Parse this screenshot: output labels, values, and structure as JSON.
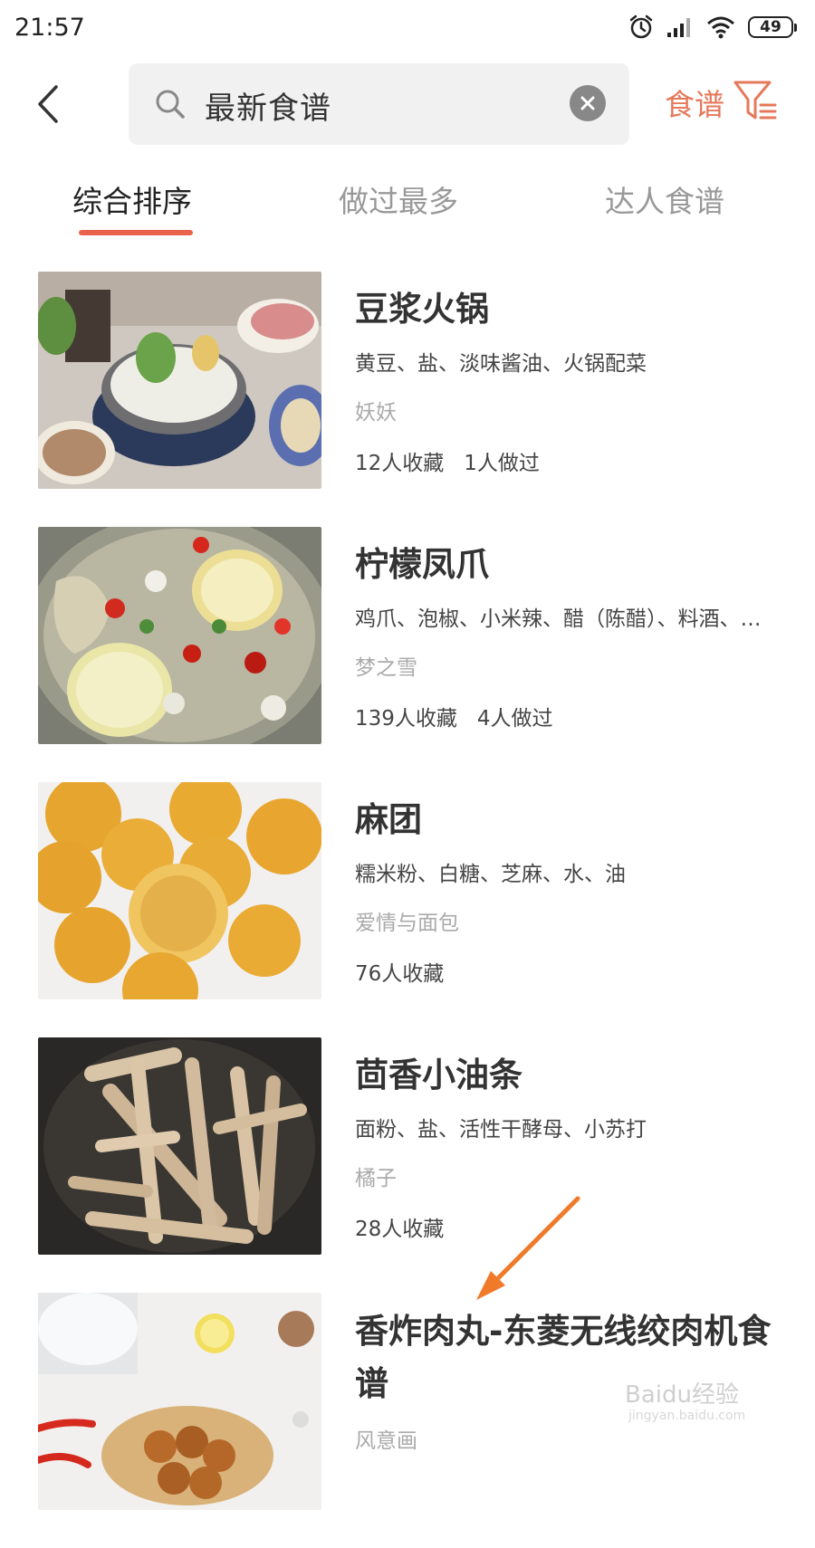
{
  "status_bar": {
    "time": "21:57",
    "battery": "49",
    "icons": [
      "alarm-icon",
      "signal-icon",
      "wifi-icon",
      "battery-icon"
    ]
  },
  "header": {
    "search_value": "最新食谱",
    "filter_label": "食谱",
    "accent_color": "#e5795a"
  },
  "tabs": [
    {
      "label": "综合排序",
      "active": true
    },
    {
      "label": "做过最多",
      "active": false
    },
    {
      "label": "达人食谱",
      "active": false
    }
  ],
  "recipes": [
    {
      "title": "豆浆火锅",
      "ingredients": "黄豆、盐、淡味酱油、火锅配菜",
      "author": "妖妖",
      "favorites": "12人收藏",
      "made": "1人做过"
    },
    {
      "title": "柠檬凤爪",
      "ingredients": "鸡爪、泡椒、小米辣、醋（陈醋）、料酒、…",
      "author": "梦之雪",
      "favorites": "139人收藏",
      "made": "4人做过"
    },
    {
      "title": "麻团",
      "ingredients": "糯米粉、白糖、芝麻、水、油",
      "author": "爱情与面包",
      "favorites": "76人收藏",
      "made": ""
    },
    {
      "title": "茴香小油条",
      "ingredients": "面粉、盐、活性干酵母、小苏打",
      "author": "橘子",
      "favorites": "28人收藏",
      "made": ""
    },
    {
      "title": "香炸肉丸-东菱无线绞肉机食谱",
      "ingredients": "",
      "author": "风意画",
      "favorites": "",
      "made": ""
    }
  ],
  "watermark": {
    "logo_text": "Baidu经验",
    "url": "jingyan.baidu.com"
  }
}
